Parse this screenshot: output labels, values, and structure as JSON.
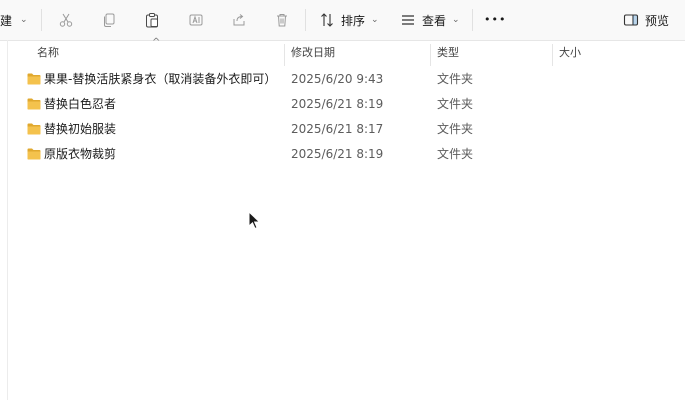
{
  "toolbar": {
    "new_label": "新建",
    "sort_label": "排序",
    "view_label": "查看",
    "more_label": "•••",
    "preview_label": "预览",
    "icons": [
      "cut-icon",
      "copy-icon",
      "paste-icon",
      "rename-icon",
      "share-icon",
      "delete-icon"
    ]
  },
  "columns": {
    "name": "名称",
    "date": "修改日期",
    "type": "类型",
    "size": "大小"
  },
  "files": [
    {
      "name": "果果-替换活肤紧身衣（取消装备外衣即可）",
      "date": "2025/6/20 9:43",
      "type": "文件夹"
    },
    {
      "name": "替换白色忍者",
      "date": "2025/6/21 8:19",
      "type": "文件夹"
    },
    {
      "name": "替换初始服装",
      "date": "2025/6/21 8:17",
      "type": "文件夹"
    },
    {
      "name": "原版衣物裁剪",
      "date": "2025/6/21 8:19",
      "type": "文件夹"
    }
  ],
  "colors": {
    "folder": "#f4c24d",
    "folder_dark": "#e0a82e",
    "accent": "#0067c0"
  }
}
